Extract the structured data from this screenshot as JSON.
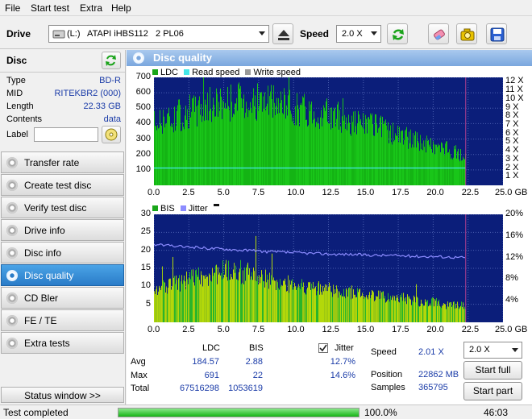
{
  "menu": [
    "File",
    "Start test",
    "Extra",
    "Help"
  ],
  "toolbar": {
    "drive_label": "Drive",
    "drive_value": "(L:)   ATAPI iHBS112   2 PL06",
    "speed_label": "Speed",
    "speed_value": "2.0 X"
  },
  "disc": {
    "title": "Disc",
    "type_k": "Type",
    "type_v": "BD-R",
    "mid_k": "MID",
    "mid_v": "RITEKBR2 (000)",
    "length_k": "Length",
    "length_v": "22.33 GB",
    "contents_k": "Contents",
    "contents_v": "data",
    "label_k": "Label",
    "label_v": ""
  },
  "nav": [
    {
      "label": "Transfer rate"
    },
    {
      "label": "Create test disc"
    },
    {
      "label": "Verify test disc"
    },
    {
      "label": "Drive info"
    },
    {
      "label": "Disc info"
    },
    {
      "label": "Disc quality"
    },
    {
      "label": "CD Bler"
    },
    {
      "label": "FE / TE"
    },
    {
      "label": "Extra tests"
    }
  ],
  "nav_selected": 5,
  "status_window_label": "Status window >>",
  "panel_title": "Disc quality",
  "legend_top": {
    "ldc": "LDC",
    "read": "Read speed",
    "write": "Write speed"
  },
  "legend_bottom": {
    "bis": "BIS",
    "jitter": "Jitter"
  },
  "colors": {
    "plot_bg": "#0b1e7a",
    "grid": "#4a5fb0",
    "ldc": "#19c619",
    "bis": "#b3d80a",
    "read": "#44e8e8",
    "jitter": "#8c8cff",
    "accent": "#2a7cc8"
  },
  "chart_data": [
    {
      "type": "area",
      "series": [
        {
          "name": "LDC",
          "x": [
            0,
            1,
            2,
            3,
            4,
            5,
            6,
            7,
            8,
            9,
            10,
            11,
            12,
            13,
            14,
            15,
            16,
            17,
            18,
            19,
            20,
            21,
            22,
            22.33
          ],
          "values": [
            430,
            450,
            490,
            520,
            550,
            570,
            580,
            580,
            570,
            555,
            535,
            515,
            495,
            470,
            445,
            420,
            395,
            365,
            330,
            300,
            270,
            245,
            210,
            200
          ]
        },
        {
          "name": "Read speed",
          "x": [
            0,
            22.33
          ],
          "values": [
            2.01,
            2.01
          ]
        }
      ],
      "xlabel_unit": "GB",
      "x_ticks": [
        "0.0",
        "2.5",
        "5.0",
        "7.5",
        "10.0",
        "12.5",
        "15.0",
        "17.5",
        "20.0",
        "22.5",
        "25.0 GB"
      ],
      "y_ticks_left": [
        "700",
        "600",
        "500",
        "400",
        "300",
        "200",
        "100"
      ],
      "y_ticks_right": [
        "12 X",
        "11 X",
        "10 X",
        "9 X",
        "8 X",
        "7 X",
        "6 X",
        "5 X",
        "4 X",
        "3 X",
        "2 X",
        "1 X"
      ],
      "xlim": [
        0,
        25
      ],
      "ylim": [
        0,
        700
      ],
      "y2lim": [
        0,
        12.5
      ],
      "grid": true
    },
    {
      "type": "area",
      "series": [
        {
          "name": "BIS",
          "x": [
            0,
            1,
            2,
            3,
            4,
            5,
            6,
            7,
            8,
            9,
            10,
            11,
            12,
            13,
            14,
            15,
            16,
            17,
            18,
            19,
            20,
            21,
            22,
            22.33
          ],
          "values": [
            10,
            11,
            12,
            13,
            14,
            15,
            15,
            14,
            13,
            12,
            11,
            10,
            10,
            9,
            9,
            8,
            8,
            7,
            7,
            6,
            6,
            5,
            5,
            5
          ]
        },
        {
          "name": "Jitter",
          "x": [
            0,
            1,
            2,
            3,
            4,
            5,
            6,
            7,
            8,
            9,
            10,
            11,
            12,
            13,
            14,
            15,
            16,
            17,
            18,
            19,
            20,
            21,
            22,
            22.33
          ],
          "values": [
            14.4,
            14.2,
            14.0,
            13.9,
            13.7,
            13.6,
            13.4,
            13.3,
            13.1,
            13.0,
            12.9,
            12.8,
            12.7,
            12.6,
            12.6,
            12.5,
            12.4,
            12.4,
            12.3,
            12.2,
            12.2,
            12.1,
            12.0,
            12.0
          ]
        }
      ],
      "xlabel_unit": "GB",
      "x_ticks": [
        "0.0",
        "2.5",
        "5.0",
        "7.5",
        "10.0",
        "12.5",
        "15.0",
        "17.5",
        "20.0",
        "22.5",
        "25.0 GB"
      ],
      "y_ticks_left": [
        "30",
        "25",
        "20",
        "15",
        "10",
        "5"
      ],
      "y_ticks_right": [
        "20%",
        "16%",
        "12%",
        "8%",
        "4%"
      ],
      "xlim": [
        0,
        25
      ],
      "ylim": [
        0,
        30
      ],
      "y2lim": [
        0,
        20
      ],
      "grid": true
    }
  ],
  "stats": {
    "h_ldc": "LDC",
    "h_bis": "BIS",
    "jitter_label": "Jitter",
    "avg_k": "Avg",
    "avg_ldc": "184.57",
    "avg_bis": "2.88",
    "avg_jit": "12.7%",
    "max_k": "Max",
    "max_ldc": "691",
    "max_bis": "22",
    "max_jit": "14.6%",
    "total_k": "Total",
    "total_ldc": "67516298",
    "total_bis": "1053619",
    "speed_k": "Speed",
    "speed_v": "2.01 X",
    "position_k": "Position",
    "position_v": "22862 MB",
    "samples_k": "Samples",
    "samples_v": "365795",
    "speed_select": "2.0 X",
    "start_full": "Start full",
    "start_part": "Start part"
  },
  "status": {
    "text": "Test completed",
    "percent": "100.0%",
    "progress": 1.0,
    "time": "46:03"
  }
}
